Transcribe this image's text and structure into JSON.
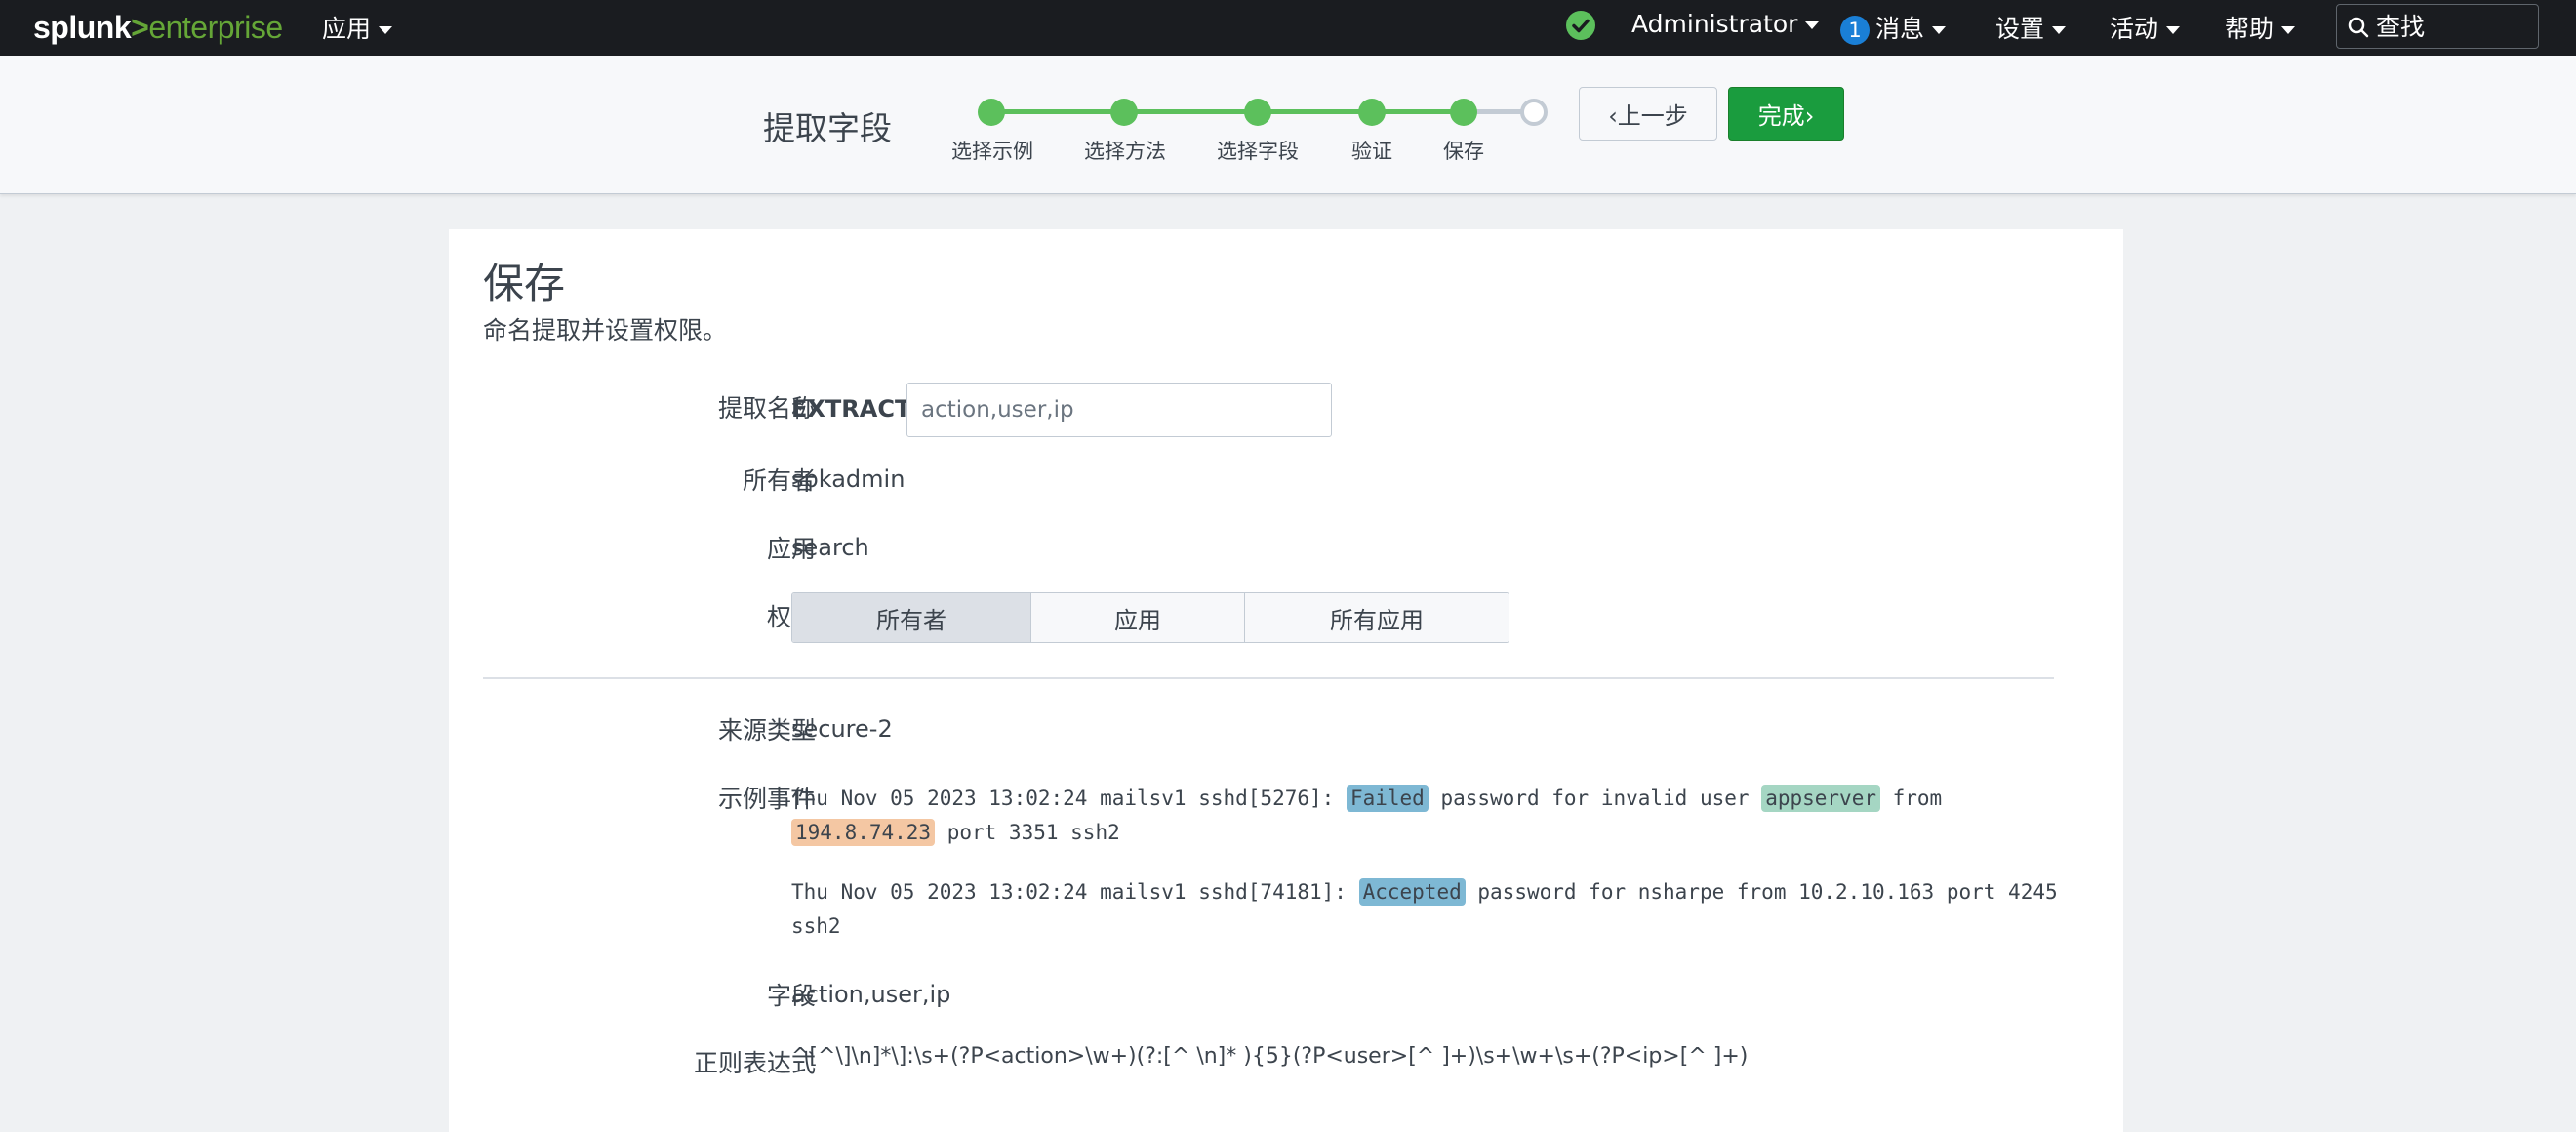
{
  "topbar": {
    "logo_left": "splunk",
    "logo_gt": ">",
    "logo_right": "enterprise",
    "apps_label": "应用",
    "status_icon": "check-circle-icon",
    "user_label": "Administrator",
    "messages_count": "1",
    "messages_label": "消息",
    "settings_label": "设置",
    "activity_label": "活动",
    "help_label": "帮助",
    "search_placeholder": "查找"
  },
  "wizard": {
    "title": "提取字段",
    "steps": [
      {
        "label": "选择示例",
        "done": true
      },
      {
        "label": "选择方法",
        "done": true
      },
      {
        "label": "选择字段",
        "done": true
      },
      {
        "label": "验证",
        "done": true
      },
      {
        "label": "保存",
        "done": true
      },
      {
        "label": "",
        "done": false
      }
    ],
    "prev_button": "上一步",
    "done_button": "完成",
    "prev_icon": "chevron-left-icon",
    "done_icon": "chevron-right-icon"
  },
  "save": {
    "title": "保存",
    "subtitle": "命名提取并设置权限。",
    "extract_name_label": "提取名称",
    "extract_prefix": "EXTRACT-",
    "extract_placeholder": "action,user,ip",
    "owner_label": "所有者",
    "owner_value": "spkadmin",
    "app_label": "应用",
    "app_value": "search",
    "permissions_label": "权限",
    "permissions": [
      "所有者",
      "应用",
      "所有应用"
    ],
    "permissions_selected": "所有者",
    "sourcetype_label": "来源类型",
    "sourcetype_value": "secure-2",
    "sample_events_label": "示例事件",
    "events": [
      {
        "t1": "Thu Nov 05 2023 13:02:24 mailsv1 sshd[5276]: ",
        "action": "Failed",
        "t2": " password for invalid user ",
        "user": "appserver",
        "t3": " from ",
        "ip": "194.8.74.23",
        "t4": " port 3351 ssh2"
      },
      {
        "t1": "Thu Nov 05 2023 13:02:24 mailsv1 sshd[74181]: ",
        "action": "Accepted",
        "t2": " password for nsharpe from 10.2.10.163 port 4245 ssh2"
      }
    ],
    "fields_label": "字段",
    "fields_value": "action,user,ip",
    "regex_label": "正则表达式",
    "regex_value": "^[^\\]\\n]*\\]:\\s+(?P<action>\\w+)(?:[^ \\n]* ){5}(?P<user>[^ ]+)\\s+\\w+\\s+(?P<ip>[^ ]+)"
  },
  "colors": {
    "topbar_bg": "#1a1c20",
    "brand_green": "#65a637",
    "step_green": "#5cc05c",
    "done_button": "#1a9c3e",
    "badge_blue": "#1a7fd6",
    "highlight_action": "#7eb8d4",
    "highlight_user": "#a5d6c3",
    "highlight_ip": "#f4c7a3"
  }
}
